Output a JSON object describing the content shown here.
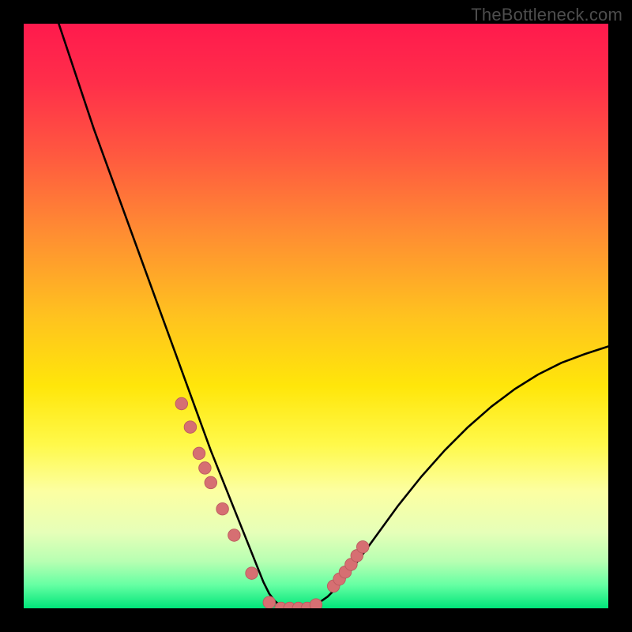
{
  "watermark": "TheBottleneck.com",
  "colors": {
    "gradient_stops": [
      {
        "offset": 0.0,
        "color": "#ff1a4d"
      },
      {
        "offset": 0.1,
        "color": "#ff2e4a"
      },
      {
        "offset": 0.22,
        "color": "#ff5740"
      },
      {
        "offset": 0.35,
        "color": "#ff8a33"
      },
      {
        "offset": 0.5,
        "color": "#ffc21f"
      },
      {
        "offset": 0.62,
        "color": "#ffe60a"
      },
      {
        "offset": 0.72,
        "color": "#fff94a"
      },
      {
        "offset": 0.8,
        "color": "#fcffa2"
      },
      {
        "offset": 0.87,
        "color": "#e6ffb8"
      },
      {
        "offset": 0.92,
        "color": "#b7ffb2"
      },
      {
        "offset": 0.96,
        "color": "#66ffa3"
      },
      {
        "offset": 1.0,
        "color": "#00e57a"
      }
    ],
    "curve": "#000000",
    "marker_fill": "#d66f72",
    "marker_stroke": "#bb5b5e"
  },
  "chart_data": {
    "type": "line",
    "title": "",
    "xlabel": "",
    "ylabel": "",
    "xlim": [
      0,
      100
    ],
    "ylim": [
      0,
      100
    ],
    "series": [
      {
        "name": "bottleneck-curve",
        "x": [
          6,
          8,
          10,
          12,
          14,
          16,
          18,
          20,
          22,
          24,
          26,
          28,
          30,
          32,
          34,
          36,
          38,
          40,
          41,
          42,
          43,
          44,
          45,
          46,
          48,
          50,
          52,
          54,
          56,
          60,
          64,
          68,
          72,
          76,
          80,
          84,
          88,
          92,
          96,
          100
        ],
        "y": [
          100,
          94,
          88,
          82,
          76.5,
          71,
          65.5,
          60,
          54.5,
          49,
          43.5,
          38,
          32.5,
          27,
          22,
          17,
          12,
          7,
          4.5,
          2.5,
          1.2,
          0.4,
          0,
          0,
          0,
          0.6,
          2,
          4,
          6.5,
          12,
          17.5,
          22.5,
          27,
          31,
          34.5,
          37.5,
          40,
          42,
          43.5,
          44.8
        ]
      }
    ],
    "markers": {
      "name": "highlight-points",
      "x": [
        27,
        28.5,
        30,
        31,
        32,
        34,
        36,
        39,
        42,
        44,
        45.5,
        47,
        48.5,
        50,
        53,
        54,
        55,
        56,
        57,
        58
      ],
      "y": [
        35,
        31,
        26.5,
        24,
        21.5,
        17,
        12.5,
        6,
        1,
        0,
        0,
        0,
        0,
        0.6,
        3.8,
        5,
        6.2,
        7.5,
        9,
        10.5
      ]
    }
  }
}
